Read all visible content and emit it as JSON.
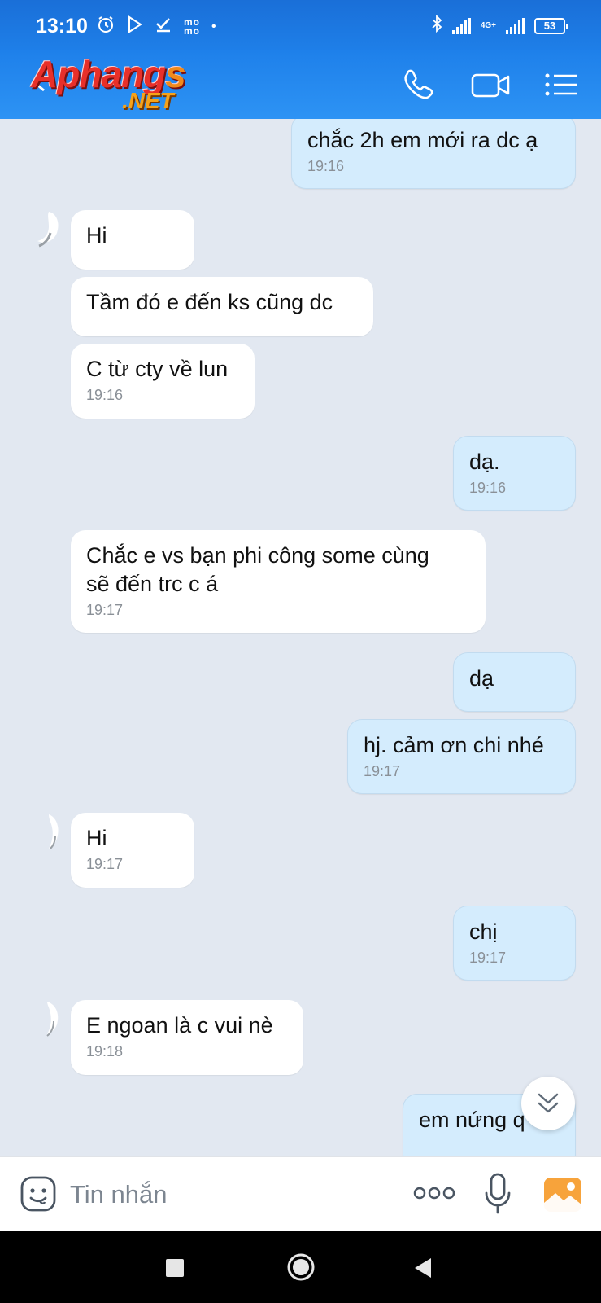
{
  "status_bar": {
    "time": "13:10",
    "momo": "mo\nmo",
    "network": "4G+",
    "battery": "53"
  },
  "header": {
    "logo_main": "Aphang",
    "logo_s": "s",
    "logo_net": ".NET",
    "accent_color": "#1e80ea"
  },
  "messages": [
    {
      "dir": "out",
      "text": "chắc 2h em mới ra dc ạ",
      "time": "19:16"
    },
    {
      "dir": "in",
      "text": "Hi",
      "time": ""
    },
    {
      "dir": "in",
      "text": "Tầm đó e đến ks cũng dc",
      "time": ""
    },
    {
      "dir": "in",
      "text": "C từ cty về lun",
      "time": "19:16"
    },
    {
      "dir": "out",
      "text": "dạ.",
      "time": "19:16"
    },
    {
      "dir": "in",
      "text": "Chắc e vs bạn phi công some cùng\nsẽ đến trc c á",
      "time": "19:17"
    },
    {
      "dir": "out",
      "text": "dạ",
      "time": ""
    },
    {
      "dir": "out",
      "text": "hj. cảm ơn chi nhé",
      "time": "19:17"
    },
    {
      "dir": "in",
      "text": "Hi",
      "time": "19:17"
    },
    {
      "dir": "out",
      "text": "chị",
      "time": "19:17"
    },
    {
      "dir": "in",
      "text": "E ngoan là c vui nè",
      "time": "19:18"
    },
    {
      "dir": "out",
      "text": "em nứng q",
      "time": ""
    }
  ],
  "input": {
    "placeholder": "Tin nhắn"
  },
  "icons": {
    "call": "phone-icon",
    "video": "video-camera-icon",
    "menu": "list-menu-icon",
    "emoji": "sticker-emoji-icon",
    "more": "more-dots-icon",
    "mic": "microphone-icon",
    "image": "image-gallery-icon",
    "scroll": "chevrons-down-icon"
  },
  "colors": {
    "incoming_bubble": "#ffffff",
    "outgoing_bubble": "#d4ecfd",
    "chat_background": "#e2e8f1"
  }
}
